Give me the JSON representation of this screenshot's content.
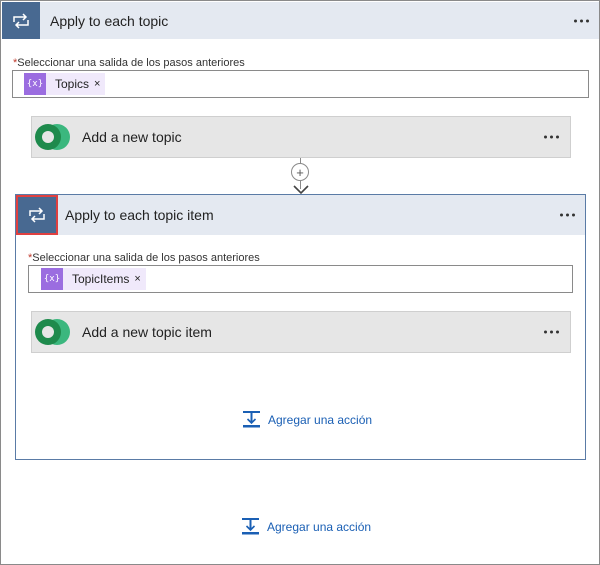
{
  "outer": {
    "title": "Apply to each topic",
    "field_label": "Seleccionar una salida de los pasos anteriores",
    "token_icon": "{x}",
    "token_label": "Topics",
    "token_close": "×",
    "action_title": "Add a new topic"
  },
  "inner": {
    "title": "Apply to each topic item",
    "field_label": "Seleccionar una salida de los pasos anteriores",
    "token_icon": "{x}",
    "token_label": "TopicItems",
    "token_close": "×",
    "action_title": "Add a new topic item",
    "add_action_label": "Agregar una acción"
  },
  "bottom": {
    "add_action_label": "Agregar una acción"
  },
  "required_marker": "*",
  "plus_symbol": "+",
  "colors": {
    "loop_header_icon_bg": "#486991",
    "header_bg": "#e4e9f1",
    "token_icon_bg": "#9b6de0",
    "link_blue": "#1a5fb4",
    "selection_red": "#e04040"
  },
  "icons": {
    "loop": "loop-icon",
    "dataverse": "dataverse-logo-icon",
    "add_step": "add-action-icon",
    "more": "more-options-icon"
  }
}
